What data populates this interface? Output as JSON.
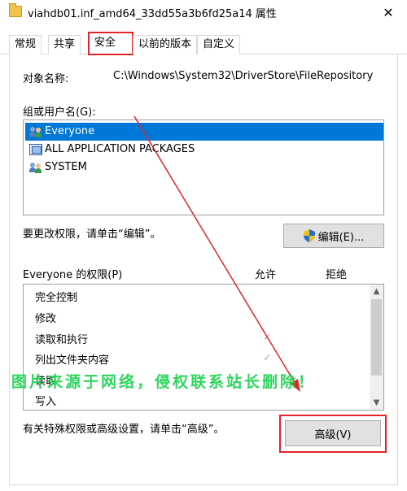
{
  "window": {
    "title": "viahdb01.inf_amd64_33dd55a3b6fd25a14 属性",
    "close_glyph": "✕"
  },
  "tabs": [
    {
      "label": "常规"
    },
    {
      "label": "共享"
    },
    {
      "label": "安全",
      "active": true
    },
    {
      "label": "以前的版本"
    },
    {
      "label": "自定义"
    }
  ],
  "object": {
    "label": "对象名称:",
    "value": "C:\\Windows\\System32\\DriverStore\\FileRepository"
  },
  "groups": {
    "label": "组或用户名(G):",
    "items": [
      {
        "name": "Everyone",
        "icon": "users-icon",
        "selected": true
      },
      {
        "name": "ALL APPLICATION PACKAGES",
        "icon": "app-packages-icon"
      },
      {
        "name": "SYSTEM",
        "icon": "users-icon"
      }
    ]
  },
  "change_perm": {
    "text": "要更改权限，请单击“编辑”。",
    "edit_button": "编辑(E)..."
  },
  "permissions": {
    "label": "Everyone 的权限(P)",
    "allow_header": "允许",
    "deny_header": "拒绝",
    "rows": [
      {
        "name": "完全控制",
        "allow": false
      },
      {
        "name": "修改",
        "allow": false
      },
      {
        "name": "读取和执行",
        "allow": true
      },
      {
        "name": "列出文件夹内容",
        "allow": true
      },
      {
        "name": "读取",
        "allow": true
      },
      {
        "name": "写入",
        "allow": false
      }
    ]
  },
  "advanced": {
    "text": "有关特殊权限或高级设置，请单击“高级”。",
    "button": "高级(V)"
  },
  "overlay": {
    "watermark": "图片来源于网络，侵权联系站长删除！",
    "annotation_color": "#e0262b",
    "watermark_color": "#19d24c"
  }
}
